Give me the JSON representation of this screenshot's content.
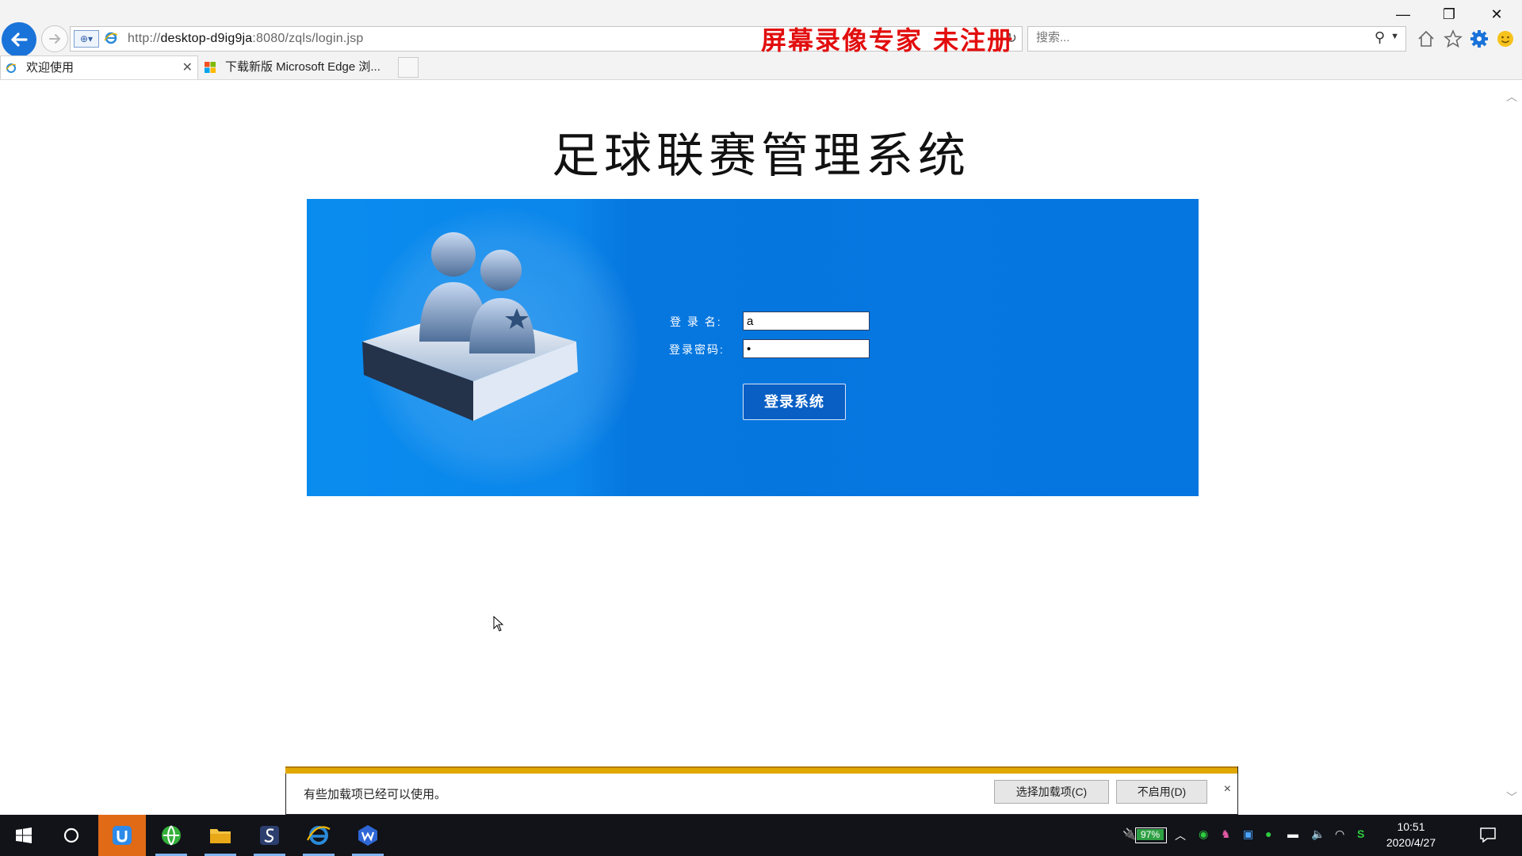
{
  "browser": {
    "url_prefix": "http://",
    "url_host": "desktop-d9ig9ja",
    "url_rest": ":8080/zqls/login.jsp",
    "search_placeholder": "搜索...",
    "watermark": "屏幕录像专家  未注册",
    "tabs": [
      {
        "label": "欢迎使用",
        "active": true
      },
      {
        "label": "下载新版 Microsoft Edge 浏...",
        "active": false
      }
    ]
  },
  "page": {
    "title": "足球联赛管理系统",
    "login": {
      "username_label": "登 录 名:",
      "password_label": "登录密码:",
      "username_value": "a",
      "password_value": "•",
      "submit_label": "登录系统"
    }
  },
  "notification": {
    "message": "有些加载项已经可以使用。",
    "choose_label": "选择加载项(C)",
    "disable_label": "不启用(D)",
    "close_label": "×"
  },
  "taskbar": {
    "battery": "97%",
    "time": "10:51",
    "date": "2020/4/27"
  },
  "colors": {
    "panel_blue": "#0575e0",
    "back_blue": "#1a73d9",
    "watermark_red": "#e20e0e",
    "notify_gold": "#e0a800"
  }
}
